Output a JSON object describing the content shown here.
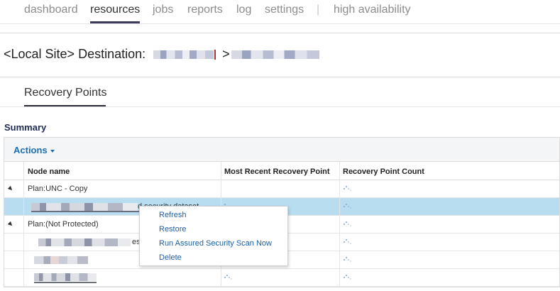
{
  "nav": {
    "items": [
      "dashboard",
      "resources",
      "jobs",
      "reports",
      "log",
      "settings"
    ],
    "separator": "|",
    "extra": "high availability",
    "active": "resources"
  },
  "page": {
    "title_prefix": "<Local Site> Destination:",
    "title_arrow": ">"
  },
  "tabs": {
    "recovery_points": "Recovery Points"
  },
  "summary": {
    "label": "Summary"
  },
  "grid": {
    "actions_label": "Actions",
    "columns": [
      "Node name",
      "Most Recent Recovery Point",
      "Recovery Point Count"
    ],
    "rows": {
      "group1": "Plan:UNC - Copy",
      "row1_suffix": "d security dataset",
      "group2": "Plan:(Not Protected)",
      "row2_suffix": "es"
    }
  },
  "context_menu": {
    "items": [
      "Refresh",
      "Restore",
      "Run Assured Security Scan Now",
      "Delete"
    ]
  },
  "colors": {
    "accent": "#1b6fb5",
    "selected_row": "#b8dcf0",
    "summary_text": "#1f2a56"
  }
}
